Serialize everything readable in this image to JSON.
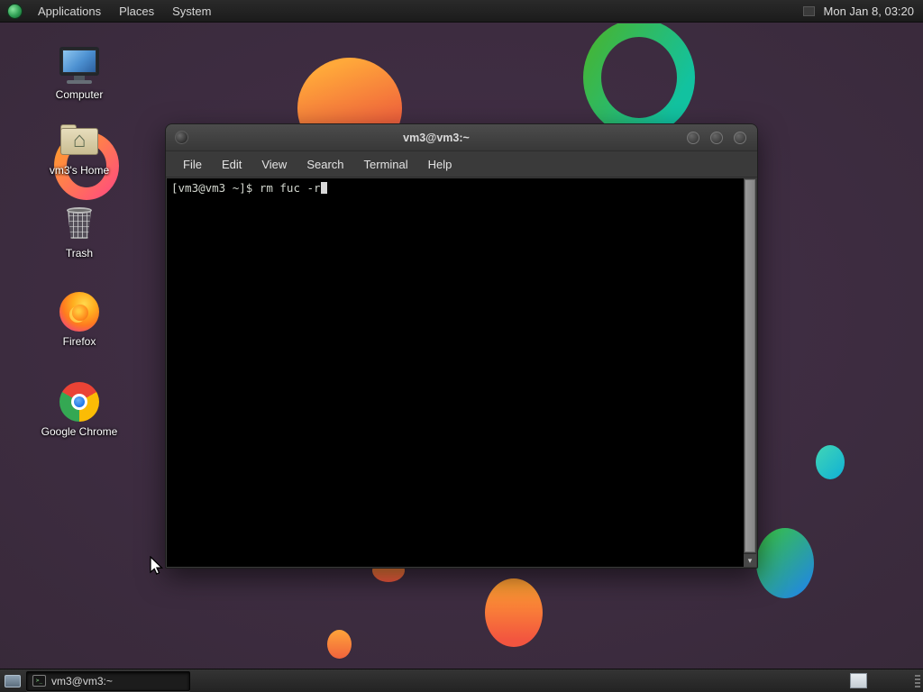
{
  "top_panel": {
    "menus": [
      {
        "label": "Applications"
      },
      {
        "label": "Places"
      },
      {
        "label": "System"
      }
    ],
    "clock": "Mon Jan 8, 03:20"
  },
  "desktop": {
    "icons": [
      {
        "label": "Computer"
      },
      {
        "label": "vm3's Home"
      },
      {
        "label": "Trash"
      },
      {
        "label": "Firefox"
      },
      {
        "label": "Google Chrome"
      }
    ]
  },
  "terminal_window": {
    "title": "vm3@vm3:~",
    "menu_items": [
      {
        "label": "File"
      },
      {
        "label": "Edit"
      },
      {
        "label": "View"
      },
      {
        "label": "Search"
      },
      {
        "label": "Terminal"
      },
      {
        "label": "Help"
      }
    ],
    "prompt_line": "[vm3@vm3 ~]$ rm fuc -r"
  },
  "bottom_panel": {
    "task_button_label": "vm3@vm3:~"
  },
  "icons": {
    "home_glyph": "⌂",
    "terminal_glyph": ">_",
    "scroll_down_glyph": "▾"
  },
  "colors": {
    "desktop_bg": "#392a3b",
    "panel_bg": "#232323",
    "terminal_bg": "#000000",
    "terminal_text": "#d3d7cf",
    "window_chrome": "#3a3a3a"
  }
}
